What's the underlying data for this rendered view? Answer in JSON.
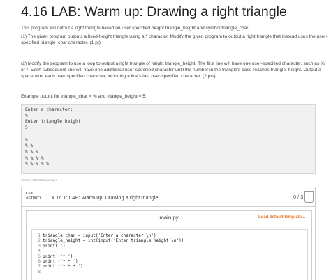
{
  "page": {
    "title": "4.16 LAB: Warm up: Drawing a right triangle",
    "intro": "This program will output a right triangle based on user specified height triangle_height and symbol triangle_char.",
    "part1": "(1) The given program outputs a fixed-height triangle using a * character. Modify the given program to output a right triangle that instead uses the user-specified triangle_char character. (1 pt)",
    "part2": "(2) Modify the program to use a loop to output a right triangle of height triangle_height. The first line will have one user-specified character, such as % or *. Each subsequent line will have one additional user-specified character until the number in the triangle's base reaches triangle_height. Output a space after each user-specified character, including a line's last user-specified character. (2 pts)",
    "example_caption": "Example output for triangle_char = % and triangle_height = 5:",
    "example_output": "Enter a character:\n%\nEnter triangle height:\n5\n\n%\n% %\n% % %\n% % % %\n% % % % %",
    "footnote": "356484.2091220.qx3zqy7"
  },
  "lab": {
    "tag_line1": "LAB",
    "tag_line2": "ACTIVITY",
    "title": "4.16.1: LAB: Warm up: Drawing a right triangle",
    "score": "0 / 3"
  },
  "editor": {
    "filename": "main.py",
    "load_template_label": "Load default template...",
    "lines": [
      {
        "n": "1",
        "code": "triangle_char = input('Enter a character:\\n')"
      },
      {
        "n": "2",
        "code": "triangle_height = int(input('Enter triangle height:\\n'))"
      },
      {
        "n": "3",
        "code": "print('')"
      },
      {
        "n": "4",
        "code": ""
      },
      {
        "n": "5",
        "code": "print ('* ')"
      },
      {
        "n": "6",
        "code": "print ('* * ')"
      },
      {
        "n": "7",
        "code": "print ('* * * ')"
      },
      {
        "n": "8",
        "code": ""
      }
    ]
  }
}
